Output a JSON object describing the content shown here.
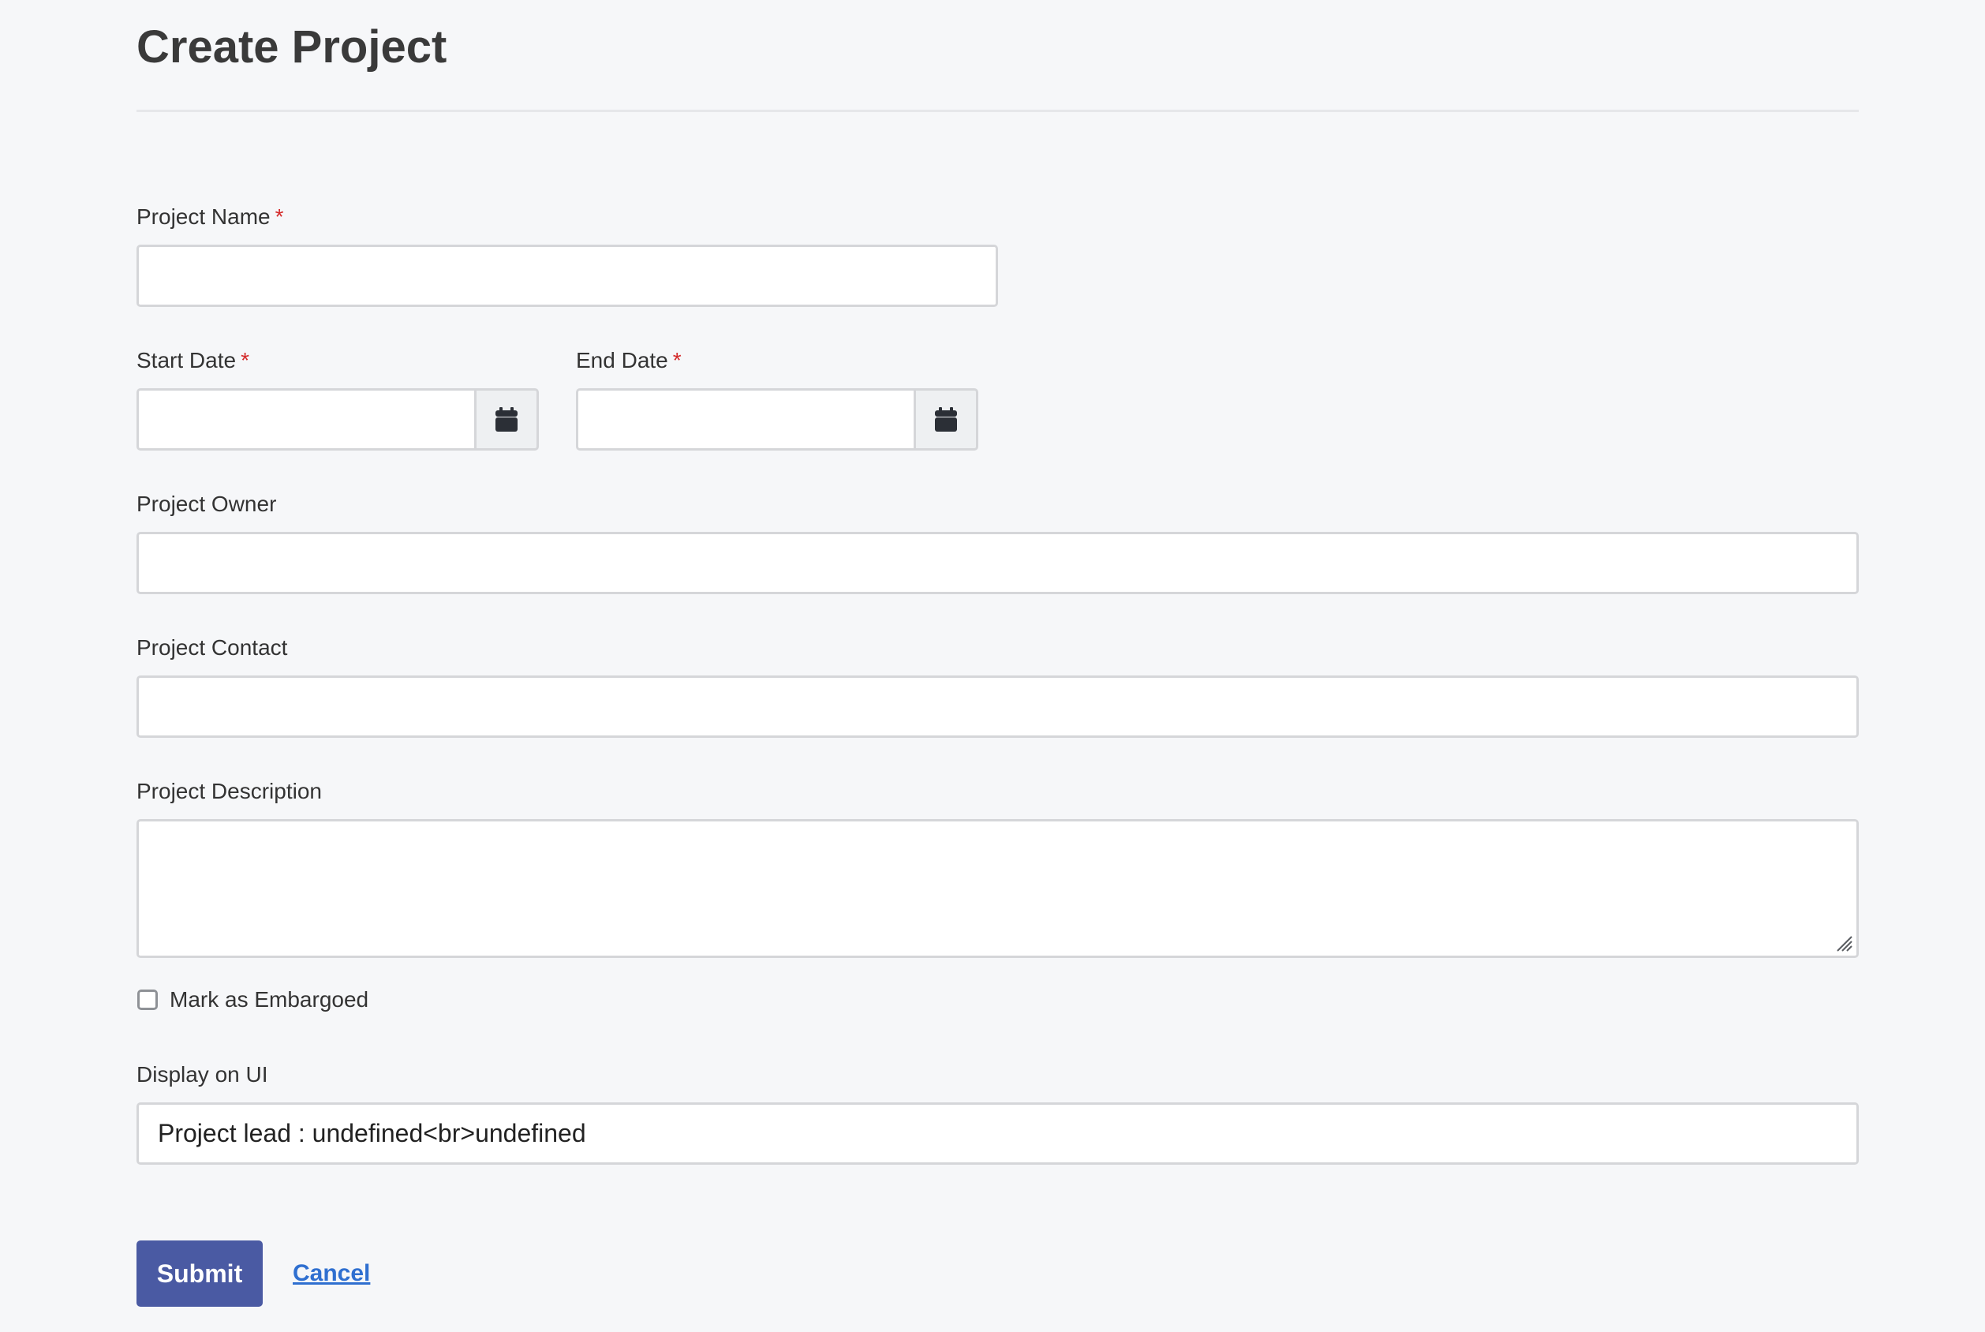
{
  "page": {
    "title": "Create Project"
  },
  "form": {
    "project_name": {
      "label": "Project Name",
      "required_mark": "*",
      "value": ""
    },
    "start_date": {
      "label": "Start Date",
      "required_mark": "*",
      "value": "",
      "icon": "calendar-icon"
    },
    "end_date": {
      "label": "End Date",
      "required_mark": "*",
      "value": "",
      "icon": "calendar-icon"
    },
    "project_owner": {
      "label": "Project Owner",
      "value": ""
    },
    "project_contact": {
      "label": "Project Contact",
      "value": ""
    },
    "project_description": {
      "label": "Project Description",
      "value": ""
    },
    "embargo": {
      "label": "Mark as Embargoed",
      "checked": false
    },
    "display_on_ui": {
      "label": "Display on UI",
      "value": "Project lead : undefined<br>undefined"
    }
  },
  "actions": {
    "submit_label": "Submit",
    "cancel_label": "Cancel"
  },
  "colors": {
    "background": "#f6f7f9",
    "primary_button": "#4a5aa3",
    "link": "#2f6fd0",
    "required": "#d42a2a",
    "border": "#d5d6d9"
  }
}
